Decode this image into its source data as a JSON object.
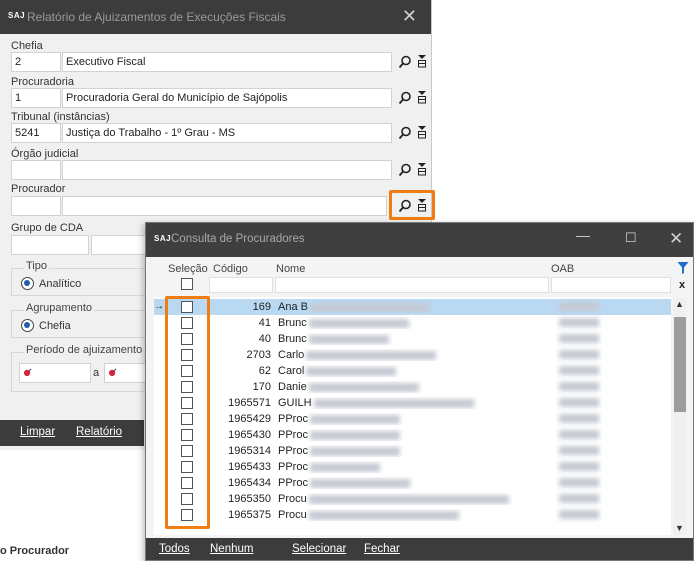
{
  "main_dialog": {
    "logo": "SAJ",
    "title": "Relatório de Ajuizamentos de Execuções Fiscais",
    "fields": {
      "chefia": {
        "label": "Chefia",
        "code": "2",
        "value": "Executivo Fiscal"
      },
      "procuradoria": {
        "label": "Procuradoria",
        "code": "1",
        "value": "Procuradoria Geral do Município de Sajópolis"
      },
      "tribunal": {
        "label": "Tribunal (instâncias)",
        "code": "5241",
        "value": "Justiça do Trabalho - 1º Grau - MS"
      },
      "orgao": {
        "label": "Órgão judicial",
        "code": "",
        "value": ""
      },
      "procurador": {
        "label": "Procurador",
        "code": "",
        "value": ""
      },
      "grupo_cda": {
        "label": "Grupo de CDA",
        "code": "",
        "value": ""
      }
    },
    "tipo": {
      "label": "Tipo",
      "option": "Analítico"
    },
    "agrupamento": {
      "label": "Agrupamento",
      "option": "Chefia"
    },
    "periodo": {
      "label": "Período de ajuizamento",
      "separator": "a"
    },
    "buttons": {
      "limpar": "Limpar",
      "relatorio": "Relatório"
    },
    "truncated_label": "o Procurador"
  },
  "consulta": {
    "logo": "SAJ",
    "title": "Consulta de Procuradores",
    "columns": {
      "selecao": "Seleção",
      "codigo": "Código",
      "nome": "Nome",
      "oab": "OAB"
    },
    "rows": [
      {
        "code": "169",
        "name": "Ana B"
      },
      {
        "code": "41",
        "name": "Brunc"
      },
      {
        "code": "40",
        "name": "Brunc"
      },
      {
        "code": "2703",
        "name": "Carlo"
      },
      {
        "code": "62",
        "name": "Carol"
      },
      {
        "code": "170",
        "name": "Danie"
      },
      {
        "code": "1965571",
        "name": "GUILH"
      },
      {
        "code": "1965429",
        "name": "PProc"
      },
      {
        "code": "1965430",
        "name": "PProc"
      },
      {
        "code": "1965314",
        "name": "PProc"
      },
      {
        "code": "1965433",
        "name": "PProc"
      },
      {
        "code": "1965434",
        "name": "PProc"
      },
      {
        "code": "1965350",
        "name": "Procu"
      },
      {
        "code": "1965375",
        "name": "Procu"
      }
    ],
    "buttons": {
      "todos": "Todos",
      "nenhum": "Nenhum",
      "selecionar": "Selecionar",
      "fechar": "Fechar"
    }
  },
  "colors": {
    "highlight": "#f07d12",
    "titlebar": "#3c3c3c",
    "selected_row": "#b9d9f3"
  }
}
